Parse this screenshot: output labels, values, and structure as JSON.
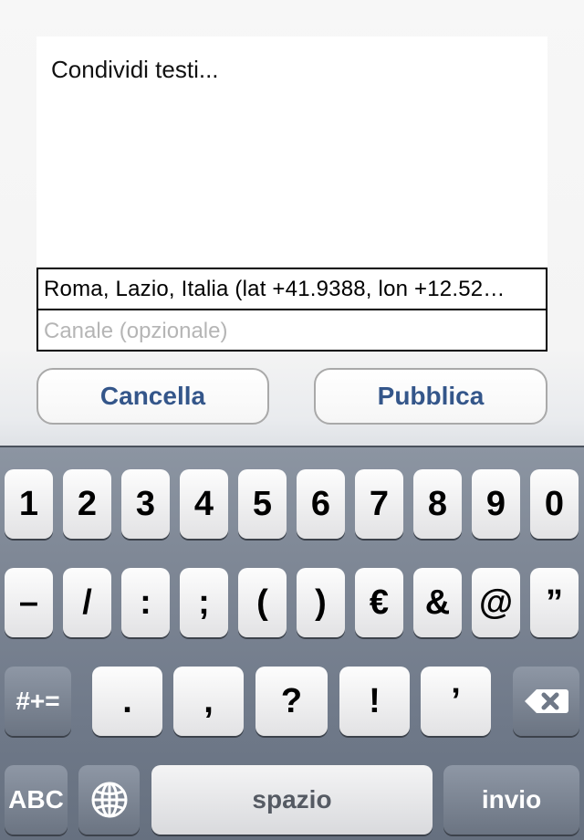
{
  "composer": {
    "placeholder": "Condividi testi..."
  },
  "location": {
    "value": "Roma, Lazio, Italia (lat +41.9388, lon +12.52…"
  },
  "channel": {
    "placeholder": "Canale (opzionale)"
  },
  "buttons": {
    "cancel": "Cancella",
    "publish": "Pubblica"
  },
  "keyboard": {
    "row1": [
      "1",
      "2",
      "3",
      "4",
      "5",
      "6",
      "7",
      "8",
      "9",
      "0"
    ],
    "row2": [
      "–",
      "/",
      ":",
      ";",
      "(",
      ")",
      "€",
      "&",
      "@",
      "”"
    ],
    "row3_left": "#+=",
    "row3": [
      ".",
      ",",
      "?",
      "!",
      "’"
    ],
    "row4_left": "ABC",
    "space": "spazio",
    "return": "invio"
  },
  "icons": {
    "delete": "backspace-icon",
    "globe": "globe-icon"
  }
}
